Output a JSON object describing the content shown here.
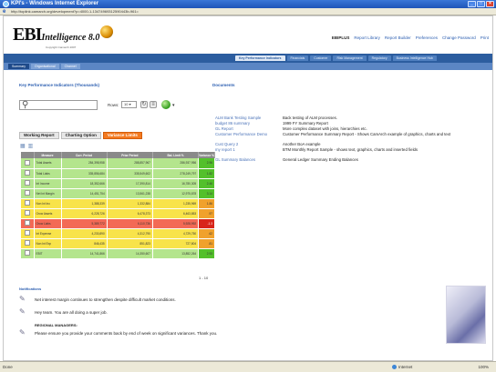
{
  "window": {
    "title": "KPI's - Windows Internet Explorer",
    "buttons": [
      "_",
      "□",
      "×"
    ]
  },
  "address": {
    "url": "http://toplink.camarch.org/development?p=4000-1-13474969312590443b-961="
  },
  "header": {
    "logo_main": "EBI",
    "logo_sub": "Intelligence 8.0",
    "logo_copy": "Copyright Camarch 2007",
    "user": "EBIPLUS",
    "links": [
      "Report Library",
      "Report Builder",
      "Preferences",
      "Change Password",
      "Print"
    ]
  },
  "nav": {
    "tabs": [
      "Key Performance Indicators",
      "Financials",
      "Customer",
      "Risk Management",
      "Regulatory",
      "Business Intelligence Hub"
    ],
    "active": 0
  },
  "subnav": {
    "tabs": [
      "Summary",
      "Organisational",
      "Channel"
    ],
    "active": 0
  },
  "kpi": {
    "title": "Key Performance Indicators (Thousands)",
    "search_placeholder": "",
    "rows_label": "Rows:",
    "rows_value": "10",
    "tabs": [
      "Working Report",
      "Charting Option",
      "Variance Limits"
    ],
    "active_tab": 2,
    "columns": [
      "",
      "Measure",
      "Curr. Period",
      "Prior Period",
      "Bal. Limit %",
      "Variance %"
    ],
    "rows": [
      {
        "name": "Total Assets",
        "curr": "284,398,958",
        "prior": "288,857,967",
        "limit": "286,937,956",
        "var": "2.96",
        "status": "green"
      },
      {
        "name": "Total Liabs",
        "curr": "335,856,684",
        "prior": "335,549,602",
        "limit": "278,249,797",
        "var": "1.82",
        "status": "green"
      },
      {
        "name": "Int Income",
        "curr": "18,352,666",
        "prior": "17,390,814",
        "limit": "16,780,305",
        "var": "2.46",
        "status": "green"
      },
      {
        "name": "Net Int Margin",
        "curr": "14,451,754",
        "prior": "13,561,238",
        "limit": "12,975,878",
        "var": "3.14",
        "status": "green"
      },
      {
        "name": "Non Int Inc",
        "curr": "1,388,339",
        "prior": "1,332,884",
        "limit": "1,235,969",
        "var": "1.86",
        "status": "yellow"
      },
      {
        "name": "Grow Assets",
        "curr": "6,228,726",
        "prior": "6,478,373",
        "limit": "6,463,853",
        "var": ".97",
        "status": "yellow"
      },
      {
        "name": "Grow Liabs",
        "curr": "5,389,772",
        "prior": "6,110,736",
        "limit": "5,928,992",
        "var": "-1.3",
        "status": "red"
      },
      {
        "name": "Int Expense",
        "curr": "4,230,890",
        "prior": "4,312,790",
        "limit": "4,729,750",
        "var": ".62",
        "status": "yellow"
      },
      {
        "name": "Non Int Exp",
        "curr": "846,435",
        "prior": "851,823",
        "limit": "727,804",
        "var": ".81",
        "status": "yellow"
      },
      {
        "name": "EBIT",
        "curr": "14,741,866",
        "prior": "14,350,607",
        "limit": "13,852,264",
        "var": "2.93",
        "status": "green"
      }
    ],
    "pager": "1 - 10"
  },
  "documents": {
    "title": "Documents",
    "items": [
      {
        "name": "ALM Bank Testing Sample",
        "desc": "Back testing of ALM processes."
      },
      {
        "name": "budget 86 summary",
        "desc": "1999 FY Summary Report"
      },
      {
        "name": "GL Report",
        "desc": "More complex dataset with joins, hierarchies etc."
      },
      {
        "name": "Customer Performance Demo",
        "desc": "Customer Performance Summary Report - Shows CamArch example of graphics, charts and text"
      },
      {
        "name": "Cust Query 2",
        "desc": "Another BoA example"
      },
      {
        "name": "my report 1",
        "desc": "BTM Monthly Report Sample - shows text, graphics, charts and inserted fields"
      },
      {
        "name": "GL Summary Balances",
        "desc": "General Ledger Summary Ending Balances"
      }
    ]
  },
  "notifications": {
    "title": "Notifications",
    "items": [
      {
        "text": "Net interest margin continues to strengthen despite difficult market conditions.",
        "bold": false
      },
      {
        "text": "Hey team. You are all doing a super job.",
        "bold": false
      },
      {
        "text": "REGIONAL MANAGERS:",
        "bold": true
      },
      {
        "text": "Please ensure you provide your comments back by end of week on significant variances. Thank you.",
        "bold": false
      }
    ]
  },
  "status": {
    "left": "Done",
    "zone": "Internet",
    "zoom": "100%"
  }
}
